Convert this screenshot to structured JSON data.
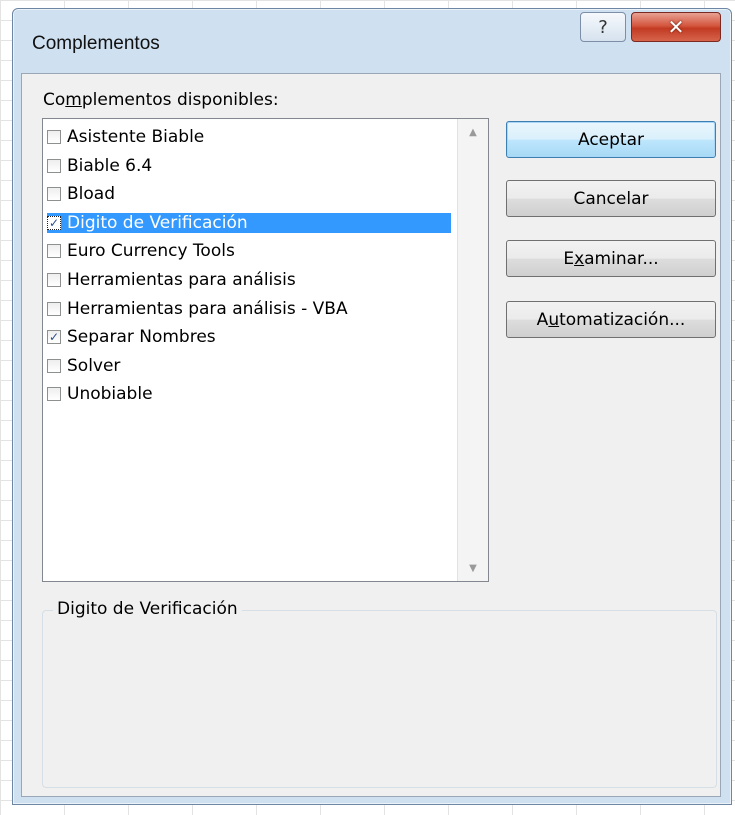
{
  "dialog": {
    "title": "Complementos",
    "help_glyph": "?",
    "close_glyph": "✕"
  },
  "available_label": {
    "pre": "Co",
    "underlined": "m",
    "post": "plementos disponibles:"
  },
  "addins": [
    {
      "label": "Asistente Biable",
      "checked": false,
      "selected": false
    },
    {
      "label": "Biable 6.4",
      "checked": false,
      "selected": false
    },
    {
      "label": "Bload",
      "checked": false,
      "selected": false
    },
    {
      "label": "Digito de Verificación",
      "checked": true,
      "selected": true
    },
    {
      "label": "Euro Currency Tools",
      "checked": false,
      "selected": false
    },
    {
      "label": "Herramientas para análisis",
      "checked": false,
      "selected": false
    },
    {
      "label": "Herramientas para análisis - VBA",
      "checked": false,
      "selected": false
    },
    {
      "label": "Separar Nombres",
      "checked": true,
      "selected": false
    },
    {
      "label": "Solver",
      "checked": false,
      "selected": false
    },
    {
      "label": "Unobiable",
      "checked": false,
      "selected": false
    }
  ],
  "buttons": {
    "ok": "Aceptar",
    "cancel": "Cancelar",
    "browse": {
      "pre": "E",
      "underlined": "x",
      "post": "aminar..."
    },
    "automation": {
      "pre": "A",
      "underlined": "u",
      "post": "tomatización..."
    }
  },
  "description": {
    "group_label": "Digito de Verificación"
  },
  "colors": {
    "selection": "#3399ff",
    "close_button": "#c23a22",
    "check_mark": "#2a4f8f"
  }
}
